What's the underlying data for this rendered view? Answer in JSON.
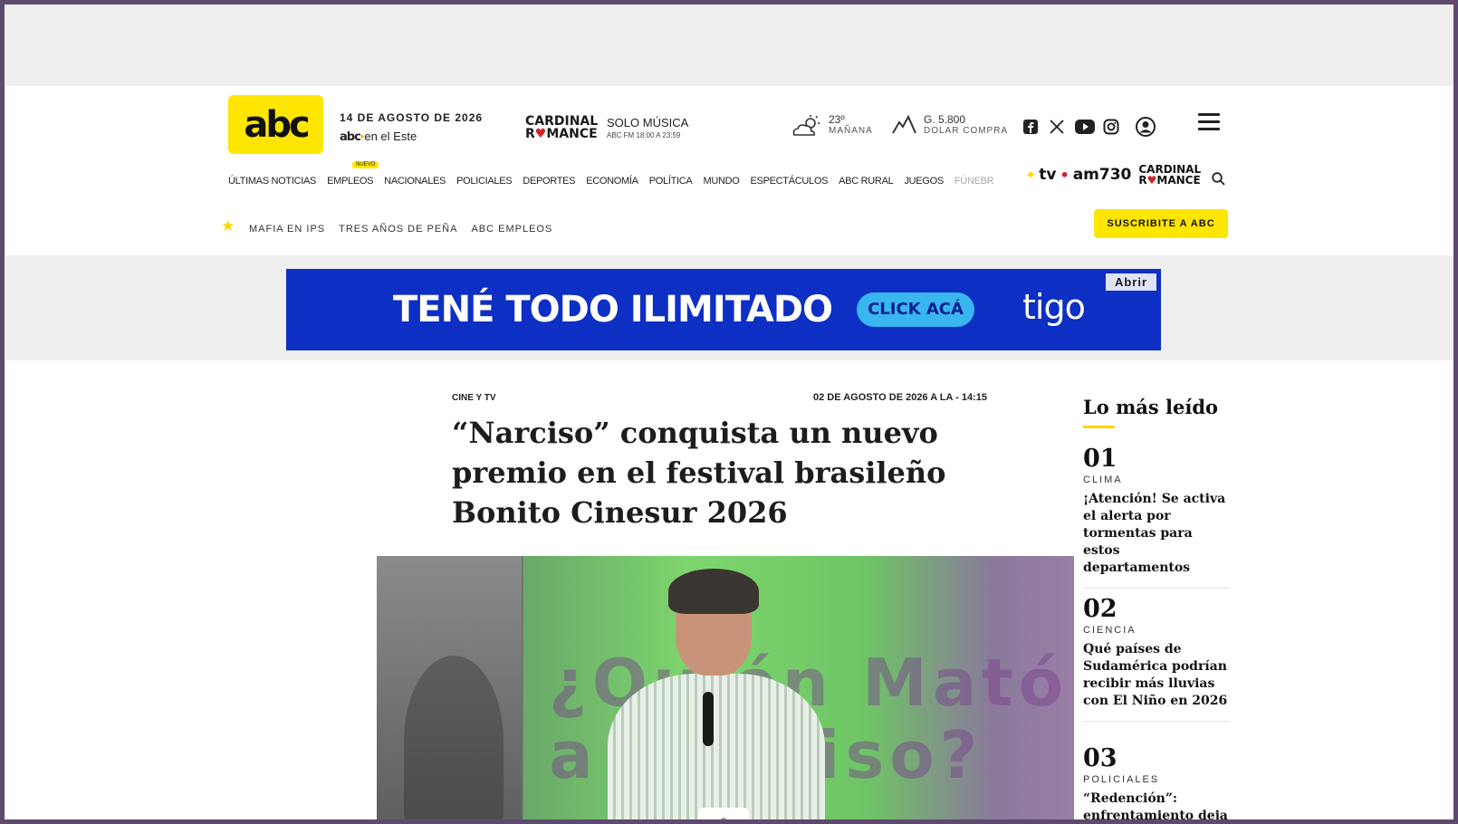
{
  "header": {
    "logo_text": "abc",
    "date": "14 DE AGOSTO DE 2026",
    "este_brand": "abc",
    "este_text": "en el Este",
    "cardinal_line1": "CARDINAL",
    "cardinal_r": "R",
    "cardinal_heart": "♥",
    "cardinal_line2": "MANCE",
    "solo_musica": "SOLO MÚSICA",
    "solo_sub": "ABC FM 18:00 A 23:59",
    "weather_temp": "23º",
    "weather_label": "MAÑANA",
    "dolar_value": "G. 5.800",
    "dolar_label": "DOLAR COMPRA"
  },
  "nav": {
    "items": [
      "ÚLTIMAS NOTICIAS",
      "EMPLEOS",
      "NACIONALES",
      "POLICIALES",
      "DEPORTES",
      "ECONOMÍA",
      "POLÍTICA",
      "MUNDO",
      "ESPECTÁCULOS",
      "ABC RURAL",
      "JUEGOS",
      "FÚNEBR"
    ],
    "badge": "NUEVO",
    "tv": "tv",
    "am": "am730",
    "cardinal_line1": "CARDINAL",
    "cardinal_line2": "MANCE"
  },
  "subnav": {
    "items": [
      "MAFIA EN IPS",
      "TRES AÑOS DE PEÑA",
      "ABC EMPLEOS"
    ],
    "subscribe": "SUSCRIBITE A ABC"
  },
  "banner": {
    "headline": "TENÉ TODO ILIMITADO",
    "cta": "CLICK ACÁ",
    "brand": "tigo",
    "open": "Abrir",
    "bg_color": "#0d2fc4"
  },
  "article": {
    "section": "CINE Y TV",
    "date": "02 DE AGOSTO DE 2026 A LA - 14:15",
    "title": "“Narciso” conquista un nuevo premio en el festival brasileño Bonito Cinesur 2026",
    "screen_text_1": "¿Quién Mató",
    "screen_text_2": "a Narciso?"
  },
  "most_read": {
    "title": "Lo más leído",
    "items": [
      {
        "num": "01",
        "category": "CLIMA",
        "headline": "¡Atención! Se activa el alerta por tormentas para estos departamentos"
      },
      {
        "num": "02",
        "category": "CIENCIA",
        "headline": "Qué países de Sudamérica podrían recibir más lluvias con El Niño en 2026"
      },
      {
        "num": "03",
        "category": "POLICIALES",
        "headline": "“Redención”: enfrentamiento deja"
      }
    ]
  },
  "colors": {
    "brand_yellow": "#ffe600",
    "accent_red": "#d2232a"
  },
  "icons": [
    "sun-cloud-icon",
    "chart-line-icon",
    "facebook-icon",
    "x-icon",
    "youtube-icon",
    "instagram-icon",
    "user-icon",
    "menu-icon",
    "search-icon",
    "star-icon",
    "chevron-up-icon"
  ]
}
